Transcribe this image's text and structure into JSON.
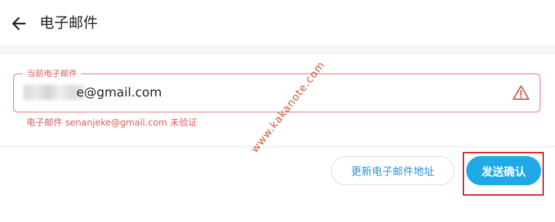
{
  "header": {
    "title": "电子邮件",
    "back_icon": "arrow-left-icon"
  },
  "email_field": {
    "label": "当前电子邮件",
    "value_visible": "e@gmail.com",
    "warning_icon": "warning-triangle-icon",
    "error_message": "电子邮件 senanjeke@gmail.com 未验证"
  },
  "actions": {
    "update_label": "更新电子邮件地址",
    "confirm_label": "发送确认"
  },
  "watermark": "www.kakanote.com",
  "colors": {
    "error": "#d95c5c",
    "primary": "#1fa9e6",
    "link": "#2c95d0",
    "highlight": "#d61f1f"
  }
}
